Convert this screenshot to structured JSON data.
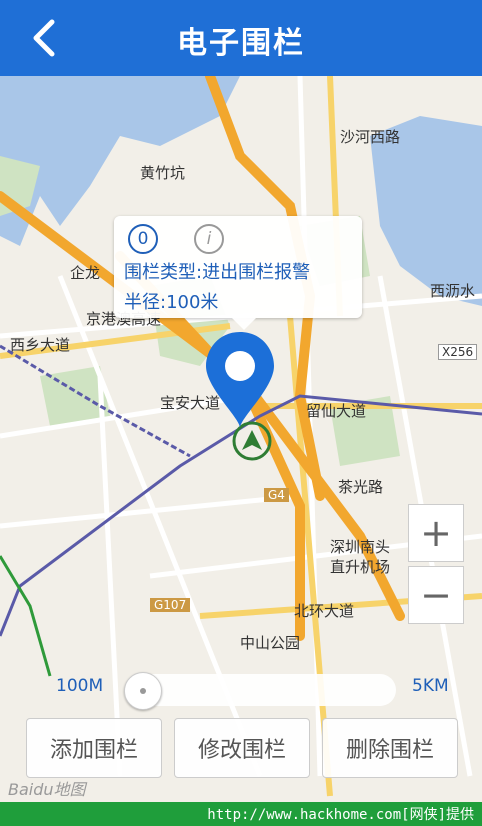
{
  "header": {
    "title": "电子围栏",
    "back_icon": "chevron-left-icon"
  },
  "map": {
    "labels": [
      "黄竹坑",
      "沙河西路",
      "企龙",
      "西沥水",
      "西乡大道",
      "宝安大道",
      "京港澳高速",
      "留仙大道",
      "茶光路",
      "G4",
      "深圳南头",
      "直升机场",
      "G107",
      "北环大道",
      "中山公园",
      "X256"
    ],
    "zoom_in": "+",
    "zoom_out": "−",
    "logo": "Baidu地图"
  },
  "info_window": {
    "badge_number": "0",
    "info_icon_text": "i",
    "type_line": "围栏类型:进出围栏报警",
    "radius_line": "半径:100米"
  },
  "radius_slider": {
    "min_label": "100M",
    "max_label": "5KM",
    "value_fraction": 0.0
  },
  "actions": [
    {
      "label": "添加围栏"
    },
    {
      "label": "修改围栏"
    },
    {
      "label": "删除围栏"
    }
  ],
  "footer": {
    "watermark": "http://www.hackhome.com[网侠]提供"
  },
  "colors": {
    "header": "#1f6fd6",
    "accent_text": "#1f5fb8",
    "footer": "#1f9e3b"
  }
}
